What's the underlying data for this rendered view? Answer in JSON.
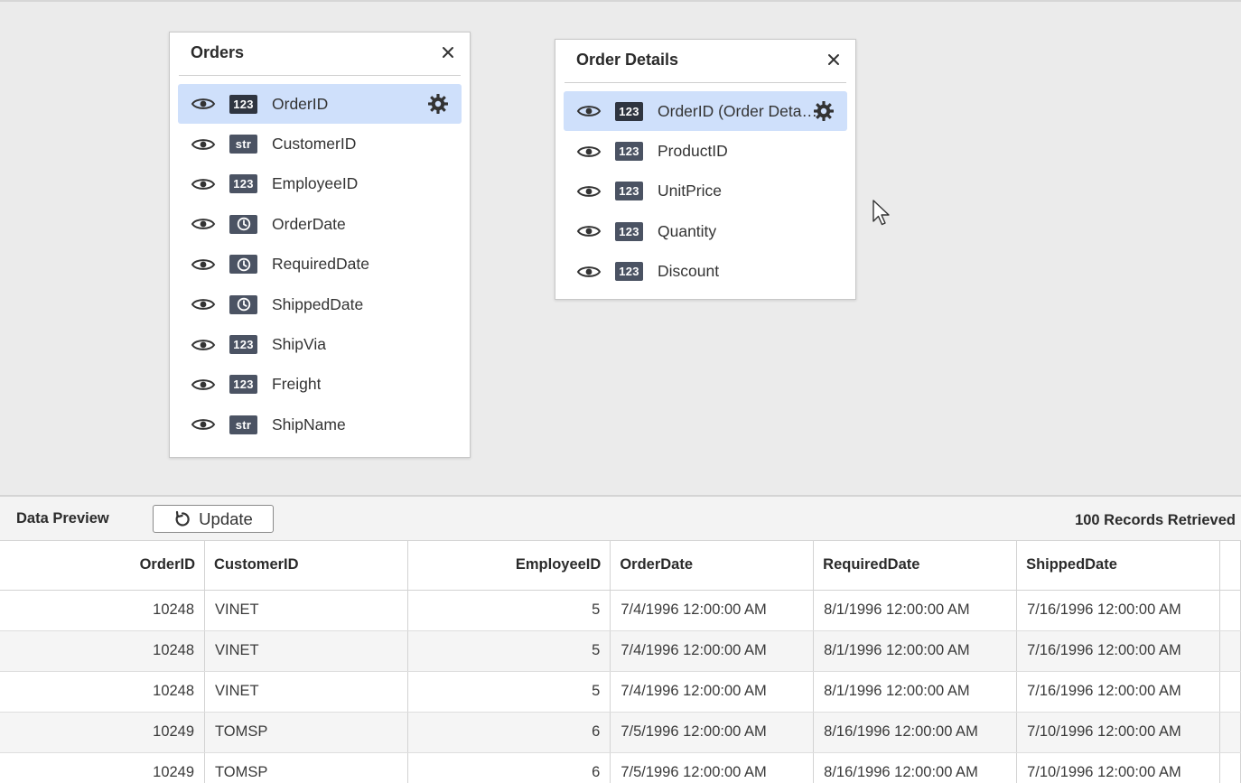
{
  "tables": [
    {
      "title": "Orders",
      "fields": [
        {
          "label": "OrderID",
          "type": "123",
          "selected": true
        },
        {
          "label": "CustomerID",
          "type": "str"
        },
        {
          "label": "EmployeeID",
          "type": "123"
        },
        {
          "label": "OrderDate",
          "type": "clock-icon"
        },
        {
          "label": "RequiredDate",
          "type": "clock-icon"
        },
        {
          "label": "ShippedDate",
          "type": "clock-icon"
        },
        {
          "label": "ShipVia",
          "type": "123"
        },
        {
          "label": "Freight",
          "type": "123"
        },
        {
          "label": "ShipName",
          "type": "str"
        }
      ]
    },
    {
      "title": "Order Details",
      "fields": [
        {
          "label": "OrderID (Order Deta…",
          "type": "123",
          "selected": true
        },
        {
          "label": "ProductID",
          "type": "123"
        },
        {
          "label": "UnitPrice",
          "type": "123"
        },
        {
          "label": "Quantity",
          "type": "123"
        },
        {
          "label": "Discount",
          "type": "123"
        }
      ]
    }
  ],
  "preview": {
    "title": "Data Preview",
    "update_label": "Update",
    "records_label": "100 Records Retrieved",
    "columns": [
      "OrderID",
      "CustomerID",
      "EmployeeID",
      "OrderDate",
      "RequiredDate",
      "ShippedDate"
    ],
    "rows": [
      [
        "10248",
        "VINET",
        "5",
        "7/4/1996 12:00:00 AM",
        "8/1/1996 12:00:00 AM",
        "7/16/1996 12:00:00 AM"
      ],
      [
        "10248",
        "VINET",
        "5",
        "7/4/1996 12:00:00 AM",
        "8/1/1996 12:00:00 AM",
        "7/16/1996 12:00:00 AM"
      ],
      [
        "10248",
        "VINET",
        "5",
        "7/4/1996 12:00:00 AM",
        "8/1/1996 12:00:00 AM",
        "7/16/1996 12:00:00 AM"
      ],
      [
        "10249",
        "TOMSP",
        "6",
        "7/5/1996 12:00:00 AM",
        "8/16/1996 12:00:00 AM",
        "7/10/1996 12:00:00 AM"
      ],
      [
        "10249",
        "TOMSP",
        "6",
        "7/5/1996 12:00:00 AM",
        "8/16/1996 12:00:00 AM",
        "7/10/1996 12:00:00 AM"
      ]
    ]
  },
  "colors": {
    "selected_row": "#cfe0fb",
    "type_badge": "#4b5363",
    "canvas_bg": "#ebebeb"
  }
}
